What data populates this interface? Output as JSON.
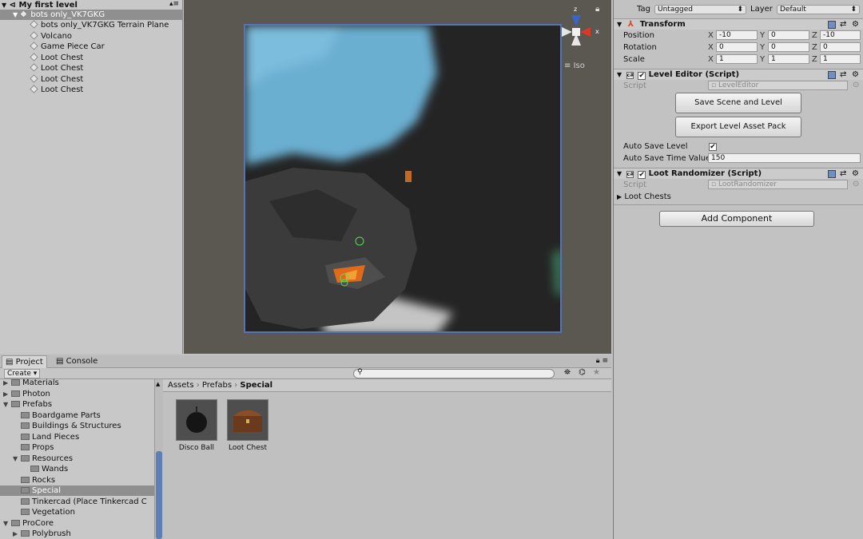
{
  "hierarchy": {
    "title": "My first level",
    "selected": "bots only_VK7GKG",
    "children": [
      "bots only_VK7GKG Terrain Plane",
      "Volcano",
      "Game Piece Car",
      "Loot Chest",
      "Loot Chest",
      "Loot Chest",
      "Loot Chest"
    ]
  },
  "scene": {
    "projection": "Iso",
    "gizmo": {
      "z": "z",
      "x": "x"
    }
  },
  "project": {
    "tabs": [
      "Project",
      "Console"
    ],
    "create_label": "Create",
    "search_placeholder": "",
    "tree": [
      {
        "label": "Materials",
        "depth": 1,
        "arrow": "▶"
      },
      {
        "label": "Photon",
        "depth": 1,
        "arrow": "▶"
      },
      {
        "label": "Prefabs",
        "depth": 1,
        "arrow": "▼"
      },
      {
        "label": "Boardgame Parts",
        "depth": 2,
        "arrow": ""
      },
      {
        "label": "Buildings & Structures",
        "depth": 2,
        "arrow": ""
      },
      {
        "label": "Land Pieces",
        "depth": 2,
        "arrow": ""
      },
      {
        "label": "Props",
        "depth": 2,
        "arrow": ""
      },
      {
        "label": "Resources",
        "depth": 2,
        "arrow": "▼"
      },
      {
        "label": "Wands",
        "depth": 3,
        "arrow": ""
      },
      {
        "label": "Rocks",
        "depth": 2,
        "arrow": ""
      },
      {
        "label": "Special",
        "depth": 2,
        "arrow": ""
      },
      {
        "label": "Tinkercad (Place Tinkercad C",
        "depth": 2,
        "arrow": ""
      },
      {
        "label": "Vegetation",
        "depth": 2,
        "arrow": ""
      },
      {
        "label": "ProCore",
        "depth": 1,
        "arrow": "▼"
      },
      {
        "label": "Polybrush",
        "depth": 2,
        "arrow": "▶"
      }
    ],
    "selected_folder": "Special",
    "breadcrumb": [
      "Assets",
      "Prefabs",
      "Special"
    ],
    "assets": [
      "Disco Ball",
      "Loot Chest"
    ]
  },
  "inspector": {
    "tag_label": "Tag",
    "tag_value": "Untagged",
    "layer_label": "Layer",
    "layer_value": "Default",
    "transform": {
      "title": "Transform",
      "position_label": "Position",
      "rotation_label": "Rotation",
      "scale_label": "Scale",
      "position": {
        "x": "-10",
        "y": "0",
        "z": "-10"
      },
      "rotation": {
        "x": "0",
        "y": "0",
        "z": "0"
      },
      "scale": {
        "x": "1",
        "y": "1",
        "z": "1"
      }
    },
    "level_editor": {
      "title": "Level Editor (Script)",
      "script_label": "Script",
      "script_value": "LevelEditor",
      "save_button": "Save Scene and Level",
      "export_button": "Export Level Asset Pack",
      "auto_save_label": "Auto Save Level",
      "auto_save_time_label": "Auto Save Time Value",
      "auto_save_time_value": "150"
    },
    "loot_randomizer": {
      "title": "Loot Randomizer (Script)",
      "script_label": "Script",
      "script_value": "LootRandomizer",
      "loot_chests_label": "Loot Chests"
    },
    "add_component": "Add Component"
  },
  "colors": {
    "selection": "#8f8f8f",
    "scene_bg": "#5b5751",
    "water": "#6aaed0",
    "lava": "#e06a1a"
  }
}
